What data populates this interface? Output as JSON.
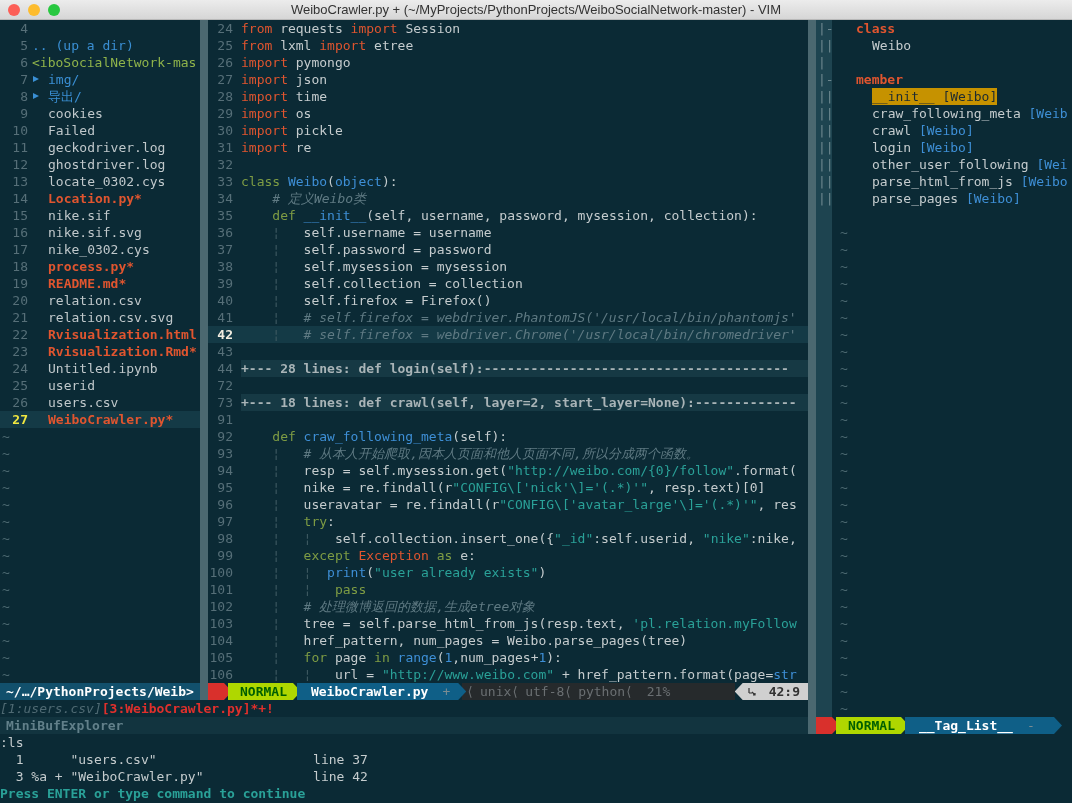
{
  "window": {
    "title": "WeiboCrawler.py + (~/MyProjects/PythonProjects/WeiboSocialNetwork-master) - VIM"
  },
  "explorer": {
    "rows": [
      {
        "number": "4",
        "kind": "blank",
        "current": false
      },
      {
        "number": "5",
        "text": ".. (up a dir)",
        "kind": "updir",
        "current": false
      },
      {
        "number": "6",
        "text": "<iboSocialNetwork-mas",
        "kind": "root",
        "current": false
      },
      {
        "number": "7",
        "text": "img/",
        "kind": "dir",
        "current": false
      },
      {
        "number": "8",
        "text": "导出/",
        "kind": "dir",
        "current": false
      },
      {
        "number": "9",
        "text": "cookies",
        "kind": "file",
        "current": false
      },
      {
        "number": "10",
        "text": "Failed",
        "kind": "file",
        "current": false
      },
      {
        "number": "11",
        "text": "geckodriver.log",
        "kind": "file",
        "current": false
      },
      {
        "number": "12",
        "text": "ghostdriver.log",
        "kind": "file",
        "current": false
      },
      {
        "number": "13",
        "text": "locate_0302.cys",
        "kind": "file",
        "current": false
      },
      {
        "number": "14",
        "text": "Location.py*",
        "kind": "modified",
        "current": false
      },
      {
        "number": "15",
        "text": "nike.sif",
        "kind": "file",
        "current": false
      },
      {
        "number": "16",
        "text": "nike.sif.svg",
        "kind": "file",
        "current": false
      },
      {
        "number": "17",
        "text": "nike_0302.cys",
        "kind": "file",
        "current": false
      },
      {
        "number": "18",
        "text": "process.py*",
        "kind": "modified",
        "current": false
      },
      {
        "number": "19",
        "text": "README.md*",
        "kind": "modified",
        "current": false
      },
      {
        "number": "20",
        "text": "relation.csv",
        "kind": "file",
        "current": false
      },
      {
        "number": "21",
        "text": "relation.csv.svg",
        "kind": "file",
        "current": false
      },
      {
        "number": "22",
        "text": "Rvisualization.html",
        "kind": "modified",
        "current": false
      },
      {
        "number": "23",
        "text": "Rvisualization.Rmd*",
        "kind": "modified",
        "current": false
      },
      {
        "number": "24",
        "text": "Untitled.ipynb",
        "kind": "file",
        "current": false
      },
      {
        "number": "25",
        "text": "userid",
        "kind": "file",
        "current": false
      },
      {
        "number": "26",
        "text": "users.csv",
        "kind": "file",
        "current": false
      },
      {
        "number": "27",
        "text": "WeiboCrawler.py*",
        "kind": "modified",
        "current": true
      }
    ],
    "filler": [
      "~",
      "~",
      "~",
      "~",
      "~",
      "~",
      "~",
      "~",
      "~",
      "~",
      "~",
      "~",
      "~",
      "~",
      "~"
    ],
    "status": {
      "path": "~/…/PythonProjects/Weib>"
    }
  },
  "editor": {
    "lines": [
      {
        "number": "24",
        "kind": "code",
        "current": false,
        "segments": [
          {
            "kind": "kw",
            "text": "from"
          },
          {
            "kind": "plain",
            "text": " requests "
          },
          {
            "kind": "kw",
            "text": "import"
          },
          {
            "kind": "plain",
            "text": " Session"
          }
        ]
      },
      {
        "number": "25",
        "kind": "code",
        "current": false,
        "segments": [
          {
            "kind": "kw",
            "text": "from"
          },
          {
            "kind": "plain",
            "text": " lxml "
          },
          {
            "kind": "kw",
            "text": "import"
          },
          {
            "kind": "plain",
            "text": " etree"
          }
        ]
      },
      {
        "number": "26",
        "kind": "code",
        "current": false,
        "segments": [
          {
            "kind": "kw",
            "text": "import"
          },
          {
            "kind": "plain",
            "text": " pymongo"
          }
        ]
      },
      {
        "number": "27",
        "kind": "code",
        "current": false,
        "segments": [
          {
            "kind": "kw",
            "text": "import"
          },
          {
            "kind": "plain",
            "text": " json"
          }
        ]
      },
      {
        "number": "28",
        "kind": "code",
        "current": false,
        "segments": [
          {
            "kind": "kw",
            "text": "import"
          },
          {
            "kind": "plain",
            "text": " time"
          }
        ]
      },
      {
        "number": "29",
        "kind": "code",
        "current": false,
        "segments": [
          {
            "kind": "kw",
            "text": "import"
          },
          {
            "kind": "plain",
            "text": " os"
          }
        ]
      },
      {
        "number": "30",
        "kind": "code",
        "current": false,
        "segments": [
          {
            "kind": "kw",
            "text": "import"
          },
          {
            "kind": "plain",
            "text": " pickle"
          }
        ]
      },
      {
        "number": "31",
        "kind": "code",
        "current": false,
        "segments": [
          {
            "kind": "kw",
            "text": "import"
          },
          {
            "kind": "plain",
            "text": " re"
          }
        ]
      },
      {
        "number": "32",
        "kind": "code",
        "current": false
      },
      {
        "number": "33",
        "kind": "code",
        "current": false,
        "segments": [
          {
            "kind": "stmt",
            "text": "class"
          },
          {
            "kind": "name",
            "text": " Weibo"
          },
          {
            "kind": "plain",
            "text": "("
          },
          {
            "kind": "name",
            "text": "object"
          },
          {
            "kind": "plain",
            "text": "):"
          }
        ]
      },
      {
        "number": "34",
        "kind": "code",
        "current": false,
        "segments": [
          {
            "kind": "comment",
            "text": "    # 定义Weibo类"
          }
        ]
      },
      {
        "number": "35",
        "kind": "code",
        "current": false,
        "segments": [
          {
            "kind": "stmt",
            "text": "    def"
          },
          {
            "kind": "name",
            "text": " __init__"
          },
          {
            "kind": "plain",
            "text": "(self, username, password, mysession, collection):"
          }
        ]
      },
      {
        "number": "36",
        "kind": "code",
        "current": false,
        "segments": [
          {
            "kind": "guide",
            "text": "    ¦"
          },
          {
            "kind": "plain",
            "text": "   self.username = username"
          }
        ]
      },
      {
        "number": "37",
        "kind": "code",
        "current": false,
        "segments": [
          {
            "kind": "guide",
            "text": "    ¦"
          },
          {
            "kind": "plain",
            "text": "   self.password = password"
          }
        ]
      },
      {
        "number": "38",
        "kind": "code",
        "current": false,
        "segments": [
          {
            "kind": "guide",
            "text": "    ¦"
          },
          {
            "kind": "plain",
            "text": "   self.mysession = mysession"
          }
        ]
      },
      {
        "number": "39",
        "kind": "code",
        "current": false,
        "segments": [
          {
            "kind": "guide",
            "text": "    ¦"
          },
          {
            "kind": "plain",
            "text": "   self.collection = collection"
          }
        ]
      },
      {
        "number": "40",
        "kind": "code",
        "current": false,
        "segments": [
          {
            "kind": "guide",
            "text": "    ¦"
          },
          {
            "kind": "plain",
            "text": "   self.firefox = Firefox()"
          }
        ]
      },
      {
        "number": "41",
        "kind": "code",
        "current": false,
        "segments": [
          {
            "kind": "guide",
            "text": "    ¦"
          },
          {
            "kind": "comment",
            "text": "   # self.firefox = webdriver.PhantomJS('/usr/local/bin/phantomjs'"
          }
        ]
      },
      {
        "number": "42",
        "kind": "code",
        "current": true,
        "segments": [
          {
            "kind": "guide",
            "text": "    ¦"
          },
          {
            "kind": "comment",
            "text": "   # self.firefox = webdriver.Chrome('/usr/local/bin/chromedriver'"
          }
        ]
      },
      {
        "number": "43",
        "kind": "code",
        "current": false
      },
      {
        "number": "44",
        "kind": "fold",
        "current": false,
        "text": "+--- 28 lines: def login(self):---------------------------------------"
      },
      {
        "number": "72",
        "kind": "code",
        "current": false
      },
      {
        "number": "73",
        "kind": "fold",
        "current": false,
        "text": "+--- 18 lines: def crawl(self, layer=2, start_layer=None):-------------"
      },
      {
        "number": "91",
        "kind": "code",
        "current": false
      },
      {
        "number": "92",
        "kind": "code",
        "current": false,
        "segments": [
          {
            "kind": "stmt",
            "text": "    def"
          },
          {
            "kind": "name",
            "text": " craw_following_meta"
          },
          {
            "kind": "plain",
            "text": "(self):"
          }
        ]
      },
      {
        "number": "93",
        "kind": "code",
        "current": false,
        "segments": [
          {
            "kind": "guide",
            "text": "    ¦"
          },
          {
            "kind": "comment",
            "text": "   # 从本人开始爬取,因本人页面和他人页面不同,所以分成两个函数。"
          }
        ]
      },
      {
        "number": "94",
        "kind": "code",
        "current": false,
        "segments": [
          {
            "kind": "guide",
            "text": "    ¦"
          },
          {
            "kind": "plain",
            "text": "   resp = self.mysession.get("
          },
          {
            "kind": "string",
            "text": "\"http://weibo.com/{0}/follow\""
          },
          {
            "kind": "plain",
            "text": ".format("
          }
        ]
      },
      {
        "number": "95",
        "kind": "code",
        "current": false,
        "segments": [
          {
            "kind": "guide",
            "text": "    ¦"
          },
          {
            "kind": "plain",
            "text": "   nike = re.findall(r"
          },
          {
            "kind": "string",
            "text": "\"CONFIG\\['nick'\\]='(.*)'\""
          },
          {
            "kind": "plain",
            "text": ", resp.text)[0]"
          }
        ]
      },
      {
        "number": "96",
        "kind": "code",
        "current": false,
        "segments": [
          {
            "kind": "guide",
            "text": "    ¦"
          },
          {
            "kind": "plain",
            "text": "   useravatar = re.findall(r"
          },
          {
            "kind": "string",
            "text": "\"CONFIG\\['avatar_large'\\]='(.*)'\""
          },
          {
            "kind": "plain",
            "text": ", res"
          }
        ]
      },
      {
        "number": "97",
        "kind": "code",
        "current": false,
        "segments": [
          {
            "kind": "guide",
            "text": "    ¦"
          },
          {
            "kind": "stmt",
            "text": "   try"
          },
          {
            "kind": "plain",
            "text": ":"
          }
        ]
      },
      {
        "number": "98",
        "kind": "code",
        "current": false,
        "segments": [
          {
            "kind": "guide",
            "text": "    ¦   ¦"
          },
          {
            "kind": "plain",
            "text": "   self.collection.insert_one({"
          },
          {
            "kind": "string",
            "text": "\"_id\""
          },
          {
            "kind": "plain",
            "text": ":self.userid, "
          },
          {
            "kind": "string",
            "text": "\"nike\""
          },
          {
            "kind": "plain",
            "text": ":nike,"
          }
        ]
      },
      {
        "number": "99",
        "kind": "code",
        "current": false,
        "segments": [
          {
            "kind": "guide",
            "text": "    ¦"
          },
          {
            "kind": "stmt",
            "text": "   except"
          },
          {
            "kind": "kw",
            "text": " Exception"
          },
          {
            "kind": "stmt",
            "text": " as"
          },
          {
            "kind": "plain",
            "text": " e:"
          }
        ]
      },
      {
        "number": "100",
        "kind": "code",
        "current": false,
        "segments": [
          {
            "kind": "guide",
            "text": "    ¦   ¦"
          },
          {
            "kind": "name",
            "text": "  print"
          },
          {
            "kind": "plain",
            "text": "("
          },
          {
            "kind": "string",
            "text": "\"user already exists\""
          },
          {
            "kind": "plain",
            "text": ")"
          }
        ]
      },
      {
        "number": "101",
        "kind": "code",
        "current": false,
        "segments": [
          {
            "kind": "guide",
            "text": "    ¦   ¦"
          },
          {
            "kind": "stmt",
            "text": "   pass"
          }
        ]
      },
      {
        "number": "102",
        "kind": "code",
        "current": false,
        "segments": [
          {
            "kind": "guide",
            "text": "    ¦"
          },
          {
            "kind": "comment",
            "text": "   # 处理微博返回的数据,生成etree对象"
          }
        ]
      },
      {
        "number": "103",
        "kind": "code",
        "current": false,
        "segments": [
          {
            "kind": "guide",
            "text": "    ¦"
          },
          {
            "kind": "plain",
            "text": "   tree = self.parse_html_from_js(resp.text, "
          },
          {
            "kind": "string",
            "text": "'pl.relation.myFollow"
          }
        ]
      },
      {
        "number": "104",
        "kind": "code",
        "current": false,
        "segments": [
          {
            "kind": "guide",
            "text": "    ¦"
          },
          {
            "kind": "plain",
            "text": "   href_pattern, num_pages = Weibo.parse_pages(tree)"
          }
        ]
      },
      {
        "number": "105",
        "kind": "code",
        "current": false,
        "segments": [
          {
            "kind": "guide",
            "text": "    ¦"
          },
          {
            "kind": "stmt",
            "text": "   for"
          },
          {
            "kind": "plain",
            "text": " page "
          },
          {
            "kind": "stmt",
            "text": "in"
          },
          {
            "kind": "name",
            "text": " range"
          },
          {
            "kind": "plain",
            "text": "("
          },
          {
            "kind": "number",
            "text": "1"
          },
          {
            "kind": "plain",
            "text": ",num_pages+"
          },
          {
            "kind": "number",
            "text": "1"
          },
          {
            "kind": "plain",
            "text": "):"
          }
        ]
      },
      {
        "number": "106",
        "kind": "code",
        "current": false,
        "segments": [
          {
            "kind": "guide",
            "text": "    ¦   ¦"
          },
          {
            "kind": "plain",
            "text": "   url = "
          },
          {
            "kind": "string",
            "text": "\"http://www.weibo.com\""
          },
          {
            "kind": "plain",
            "text": " + href_pattern.format(page="
          },
          {
            "kind": "name",
            "text": "str"
          }
        ]
      }
    ],
    "status": {
      "mode": "NORMAL",
      "file": "WeiboCrawler.py",
      "modified": "+",
      "separator": "⟨",
      "info": [
        "unix",
        "utf-8",
        "python"
      ],
      "percent": "21%",
      "position": "42:9"
    }
  },
  "taglist": {
    "rows": [
      {
        "fold": "|-",
        "kind": "heading",
        "text": "class"
      },
      {
        "fold": "||",
        "kind": "tag",
        "text": "Weibo",
        "selected": false
      },
      {
        "fold": "|",
        "kind": "blank"
      },
      {
        "fold": "|-",
        "kind": "heading",
        "text": "member"
      },
      {
        "fold": "||",
        "kind": "tag",
        "text": "__init__",
        "scope": "[Weibo]",
        "selected": true
      },
      {
        "fold": "||",
        "kind": "tag",
        "text": "craw_following_meta",
        "scope": "[Weib",
        "selected": false
      },
      {
        "fold": "||",
        "kind": "tag",
        "text": "crawl",
        "scope": "[Weibo]",
        "selected": false
      },
      {
        "fold": "||",
        "kind": "tag",
        "text": "login",
        "scope": "[Weibo]",
        "selected": false
      },
      {
        "fold": "||",
        "kind": "tag",
        "text": "other_user_following",
        "scope": "[Wei",
        "selected": false
      },
      {
        "fold": "||",
        "kind": "tag",
        "text": "parse_html_from_js",
        "scope": "[Weibo",
        "selected": false
      },
      {
        "fold": "||",
        "kind": "tag",
        "text": "parse_pages",
        "scope": "[Weibo]",
        "selected": false
      },
      {
        "kind": "blank"
      }
    ],
    "filler": [
      "~",
      "~",
      "~",
      "~",
      "~",
      "~",
      "~",
      "~",
      "~",
      "~",
      "~",
      "~",
      "~",
      "~",
      "~",
      "~",
      "~",
      "~",
      "~",
      "~",
      "~",
      "~",
      "~",
      "~",
      "~",
      "~",
      "~",
      "~",
      "~"
    ],
    "status": {
      "mode": "NORMAL",
      "name": "__Tag_List__",
      "flag": "-"
    }
  },
  "buffers": {
    "items": [
      {
        "text": "[1:users.csv]",
        "active": false
      },
      {
        "text": "[3:WeiboCrawler.py]*+!",
        "active": true
      }
    ],
    "status": "MiniBufExplorer"
  },
  "command": {
    "input": ":ls",
    "rows": [
      "  1      \"users.csv\"                    line 37",
      "  3 %a + \"WeiboCrawler.py\"              line 42"
    ],
    "prompt": "Press ENTER or type command to continue"
  }
}
